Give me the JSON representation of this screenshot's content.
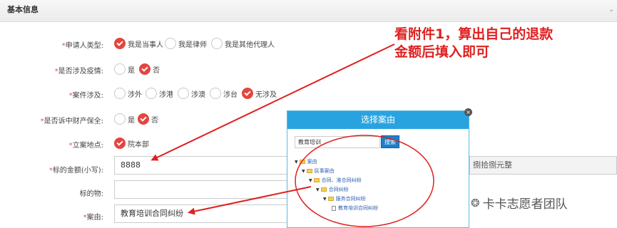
{
  "header": {
    "title": "基本信息"
  },
  "form": {
    "applicant_type": {
      "label": "申请人类型:",
      "options": [
        "我是当事人",
        "我是律师",
        "我是其他代理人"
      ],
      "selected": 0
    },
    "epidemic": {
      "label": "是否涉及疫情:",
      "options": [
        "是",
        "否"
      ],
      "selected": 1
    },
    "case_involves": {
      "label": "案件涉及:",
      "options": [
        "涉外",
        "涉港",
        "涉澳",
        "涉台",
        "无涉及"
      ],
      "selected": 4
    },
    "preservation": {
      "label": "是否诉中财产保全:",
      "options": [
        "是",
        "否"
      ],
      "selected": 1
    },
    "filing_location": {
      "label": "立案地点:",
      "options": [
        "院本部"
      ],
      "selected": 0
    },
    "amount": {
      "label": "标的金额(小写):",
      "value": "8888",
      "uppercase_partial": "捌拾捌元整"
    },
    "subject": {
      "label": "标的物:",
      "value": ""
    },
    "cause": {
      "label": "案由:",
      "value": "教育培训合同纠纷"
    }
  },
  "annotation": {
    "line1": "看附件1，算出自己的退款",
    "line2": "金额后填入即可"
  },
  "dialog": {
    "title": "选择案由",
    "close_glyph": "×",
    "search_value": "教育培训",
    "search_button": "搜索",
    "tree": [
      {
        "label": "案由",
        "level": 0,
        "kind": "folder"
      },
      {
        "label": "民事案由",
        "level": 1,
        "kind": "folder"
      },
      {
        "label": "合同、准合同纠纷",
        "level": 2,
        "kind": "folder"
      },
      {
        "label": "合同纠纷",
        "level": 3,
        "kind": "folder"
      },
      {
        "label": "服务合同纠纷",
        "level": 4,
        "kind": "folder"
      },
      {
        "label": "教育培训合同纠纷",
        "level": 5,
        "kind": "file"
      }
    ]
  },
  "watermark": {
    "text": "卡卡志愿者团队",
    "icon": "wechat-icon"
  },
  "colors": {
    "accent": "#e2463f",
    "dialog_header": "#29a3e0",
    "annotation": "#e02020"
  }
}
